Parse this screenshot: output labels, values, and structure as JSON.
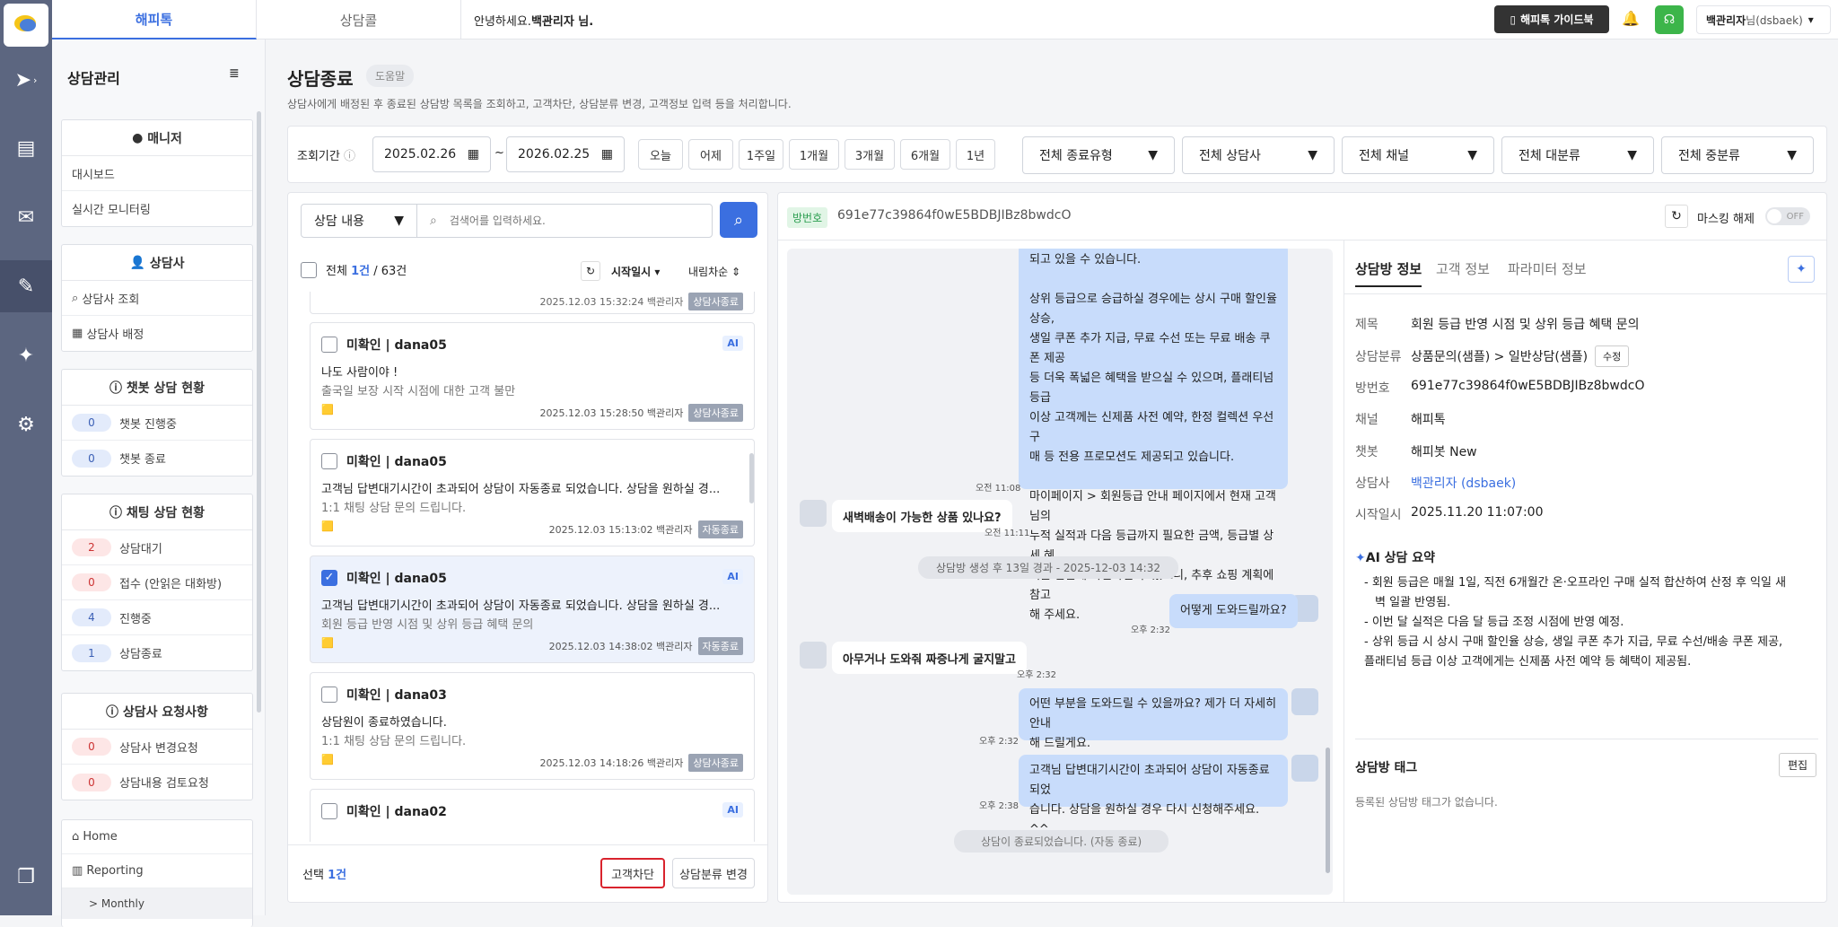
{
  "app": {
    "top_tabs": [
      "해피톡",
      "상담콜"
    ],
    "greeting_prefix": "안녕하세요.",
    "greeting_name": "백관리자 님.",
    "guide_button": "해피톡 가이드북",
    "user": "백관리자",
    "user_suffix": "님(dsbaek)",
    "colors": {
      "accent": "#3b6fe0",
      "rail": "#5c6680",
      "selected_row": "#edf2fc",
      "bubble": "#c8dcfb"
    }
  },
  "sidebar": {
    "title": "상담관리",
    "sections": [
      {
        "header": "매니저",
        "icon": "user-circle-icon",
        "items": [
          {
            "label": "대시보드"
          },
          {
            "label": "실시간 모니터링"
          }
        ]
      },
      {
        "header": "상담사",
        "icon": "user-icon",
        "items": [
          {
            "label": "상담사 조회",
            "icon": "search-icon"
          },
          {
            "label": "상담사 배정",
            "icon": "calendar-icon"
          }
        ]
      },
      {
        "header": "챗봇 상담 현황",
        "icon": "info-icon",
        "items": [
          {
            "count": "0",
            "label": "챗봇 진행중"
          },
          {
            "count": "0",
            "label": "챗봇 종료"
          }
        ]
      },
      {
        "header": "채팅 상담 현황",
        "icon": "info-icon",
        "items": [
          {
            "count": "2",
            "label": "상담대기"
          },
          {
            "count": "0",
            "label": "접수 (안읽은 대화방)"
          },
          {
            "count": "4",
            "label": "진행중"
          },
          {
            "count": "1",
            "label": "상담종료"
          }
        ]
      },
      {
        "header": "상담사 요청사항",
        "icon": "info-icon",
        "items": [
          {
            "count": "0",
            "label": "상담사 변경요청"
          },
          {
            "count": "0",
            "label": "상담내용 검토요청"
          }
        ]
      }
    ],
    "bottom": [
      {
        "label": "Home"
      },
      {
        "label": "Reporting"
      },
      {
        "label": "> Monthly"
      }
    ]
  },
  "page": {
    "title": "상담종료",
    "help": "도움말",
    "description": "상담사에게 배정된 후 종료된 상담방 목록을 조회하고, 고객차단, 상담분류 변경, 고객정보 입력 등을 처리합니다."
  },
  "filters": {
    "period_label": "조회기간",
    "start": "2025.02.26",
    "end": "2026.02.25",
    "sep": "~",
    "quick": [
      "오늘",
      "어제",
      "1주일",
      "1개월",
      "3개월",
      "6개월",
      "1년"
    ],
    "selects": [
      "전체 종료유형",
      "전체 상담사",
      "전체 채널",
      "전체 대분류",
      "전체 중분류"
    ]
  },
  "search": {
    "type": "상담 내용",
    "placeholder": "검색어를 입력하세요."
  },
  "list": {
    "total_prefix": "전체",
    "selected": "1건",
    "total_suffix": "/ 63건",
    "sort": "시작일시",
    "order": "내림차순",
    "partial_top": {
      "date": "2025.12.03 15:32:24",
      "agent": "백관리자",
      "status": "상담사종료"
    },
    "items": [
      {
        "name": "미확인 | dana05",
        "ai": "AI",
        "msg": "나도 사람이야 !",
        "sub": "출국일 보장 시작 시점에 대한 고객 불만",
        "date": "2025.12.03 15:28:50",
        "agent": "백관리자",
        "status": "상담사종료"
      },
      {
        "name": "미확인 | dana05",
        "ai": "",
        "msg": "고객님 답변대기시간이 초과되어 상담이 자동종료 되었습니다. 상담을 원하실 경...",
        "sub": "1:1 채팅 상담 문의 드립니다.",
        "date": "2025.12.03 15:13:02",
        "agent": "백관리자",
        "status": "자동종료"
      },
      {
        "name": "미확인 | dana05",
        "ai": "AI",
        "msg": "고객님 답변대기시간이 초과되어 상담이 자동종료 되었습니다. 상담을 원하실 경...",
        "sub": "회원 등급 반영 시점 및 상위 등급 혜택 문의",
        "date": "2025.12.03 14:38:02",
        "agent": "백관리자",
        "status": "자동종료",
        "checked": true
      },
      {
        "name": "미확인 | dana03",
        "ai": "",
        "msg": "상담원이 종료하였습니다.",
        "sub": "1:1 채팅 상담 문의 드립니다.",
        "date": "2025.12.03 14:18:26",
        "agent": "백관리자",
        "status": "상담사종료"
      },
      {
        "name": "미확인 | dana02",
        "ai": "AI",
        "msg": "",
        "sub": "",
        "date": "",
        "agent": "",
        "status": ""
      }
    ],
    "footer": {
      "label": "선택",
      "count": "1건",
      "block": "고객차단",
      "change": "상담분류 변경"
    }
  },
  "chat": {
    "room_label": "방번호",
    "room_id": "691e77c39864f0wE5BDBJIBz8bwdcO",
    "masking": "마스킹 해제",
    "toggle": "OFF",
    "bubble1": [
      "되고 있을 수 있습니다.",
      "",
      "상위 등급으로 승급하실 경우에는 상시 구매 할인율 상승,",
      "생일 쿠폰 추가 지급, 무료 수선 또는 무료 배송 쿠폰 제공",
      "등 더욱 폭넓은 혜택을 받으실 수 있으며, 플래티넘 등급",
      "이상 고객께는 신제품 사전 예약, 한정 컬렉션 우선 구",
      "매 등 전용 프로모션도 제공되고 있습니다.",
      "",
      "마이페이지 > 회원등급 안내 페이지에서 현재 고객님의",
      "누적 실적과 다음 등급까지 필요한 금액, 등급별 상세 혜",
      "택을 한눈에 확인하실 수 있으니, 추후 쇼핑 계획에 참고",
      "해 주세요."
    ],
    "t1": "오전 11:08",
    "user_q1": "새벽배송이 가능한 상품 있나요?",
    "t2": "오전 11:11",
    "divider": "상담방 생성 후 13일 경과 - 2025-12-03 14:32",
    "bot1": "어떻게 도와드릴까요?",
    "t3": "오후 2:32",
    "user_q2": "아무거나 도와줘 짜증나게 굴지말고",
    "t4": "오후 2:32",
    "bot2": [
      "어떤 부분을 도와드릴 수 있을까요? 제가 더 자세히 안내",
      "해 드릴게요."
    ],
    "t5": "오후 2:32",
    "bot3": [
      "고객님 답변대기시간이 초과되어 상담이 자동종료 되었",
      "습니다. 상담을 원하실 경우 다시 신청해주세요. ^^"
    ],
    "t6": "오후 2:38",
    "end": "상담이 종료되었습니다. (자동 종료)"
  },
  "detail": {
    "tabs": [
      "상담방 정보",
      "고객 정보",
      "파라미터 정보"
    ],
    "rows": [
      {
        "k": "제목",
        "v": "회원 등급 반영 시점 및 상위 등급 혜택 문의"
      },
      {
        "k": "상담분류",
        "v": "상품문의(샘플) > 일반상담(샘플)"
      },
      {
        "k": "방번호",
        "v": "691e77c39864f0wE5BDBJIBz8bwdcO"
      },
      {
        "k": "채널",
        "v": "해피톡"
      },
      {
        "k": "챗봇",
        "v": "해피봇 New"
      },
      {
        "k": "상담사",
        "v": "백관리자 (dsbaek)"
      },
      {
        "k": "시작일시",
        "v": "2025.11.20 11:07:00"
      }
    ],
    "edit_class": "수정",
    "ai_title": "AI 상담 요약",
    "ai_lines": [
      "- 회원 등급은 매월 1일, 직전 6개월간 온·오프라인 구매 실적 합산하여 산정 후 익일 새",
      "벽 일괄 반영됨.",
      "- 이번 달 실적은 다음 달 등급 조정 시점에 반영 예정.",
      "- 상위 등급 시 상시 구매 할인율 상승, 생일 쿠폰 추가 지급, 무료 수선/배송 쿠폰 제공,",
      "플래티넘 등급 이상 고객에게는 신제품 사전 예약 등 혜택이 제공됨."
    ],
    "tag_title": "상담방 태그",
    "tag_edit": "편집",
    "tag_empty": "등록된 상담방 태그가 없습니다."
  }
}
